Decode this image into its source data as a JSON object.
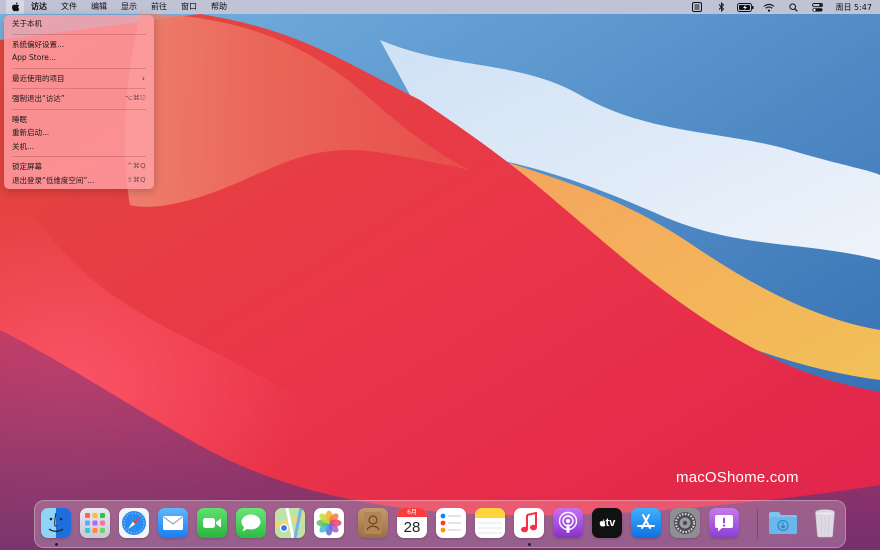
{
  "menubar": {
    "app_name": "访达",
    "items": [
      "文件",
      "编辑",
      "显示",
      "前往",
      "窗口",
      "帮助"
    ],
    "clock": "周日 5:47",
    "status_icons": [
      "keyboard-input-icon",
      "bluetooth-icon",
      "battery-icon",
      "wifi-icon",
      "search-icon",
      "control-center-icon"
    ]
  },
  "apple_menu": {
    "about": "关于本机",
    "preferences": "系统偏好设置...",
    "app_store": "App Store...",
    "recent_items": "最近使用的项目",
    "force_quit": "强制退出“访达”",
    "force_quit_shortcut": "⌥⌘⎋",
    "sleep": "睡眠",
    "restart": "重新启动...",
    "shutdown": "关机...",
    "lock_screen": "锁定屏幕",
    "lock_screen_shortcut": "^⌘Q",
    "logout": "退出登录“低维度空间”...",
    "logout_shortcut": "⇧⌘Q"
  },
  "watermark": "macOShome.com",
  "dock": {
    "calendar_month": "6月",
    "calendar_day": "28",
    "tv_label": "tv",
    "apps": [
      "finder",
      "launchpad",
      "safari",
      "mail",
      "facetime",
      "messages",
      "maps",
      "photos",
      "contacts",
      "calendar",
      "reminders",
      "notes",
      "music",
      "podcasts",
      "tv",
      "app-store",
      "system-preferences",
      "feedback-assistant",
      "downloads",
      "trash"
    ]
  },
  "colors": {
    "menu_background": "#ffa0a5",
    "wallpaper_blue": "#3a7bbf",
    "wallpaper_red": "#e8344a",
    "wallpaper_orange": "#f0a040"
  }
}
